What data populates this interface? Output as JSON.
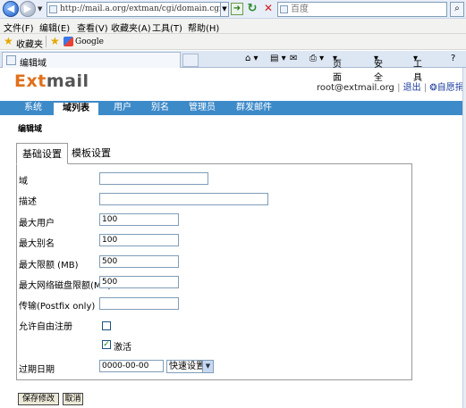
{
  "browser": {
    "address": "http://mail.а.org/extman/cgi/domain.cgi?_",
    "search_placeholder": "百度",
    "menu": [
      "文件(F)",
      "编辑(E)",
      "查看(V)",
      "收藏夹(A)",
      "工具(T)",
      "帮助(H)"
    ],
    "favorites_label": "收藏夹",
    "favorite_link": "Google",
    "tab_title": "编辑域",
    "toolbar": {
      "page": "页面",
      "safety": "安全",
      "tools": "工具"
    }
  },
  "app": {
    "logo_ext": "Ext",
    "logo_mail": "mail",
    "user": "root@extmail.org",
    "sep1": "|",
    "logout": "退出",
    "sep2": "|",
    "donate": "自愿捐助"
  },
  "nav": [
    "系统",
    "域列表",
    "用户",
    "别名",
    "管理员",
    "群发邮件"
  ],
  "page_title": "编辑域",
  "form_tabs": [
    "基础设置",
    "模板设置"
  ],
  "fields": {
    "domain_label": "域",
    "domain_value": "",
    "desc_label": "描述",
    "desc_value": "",
    "max_users_label": "最大用户",
    "max_users_value": "100",
    "max_alias_label": "最大别名",
    "max_alias_value": "100",
    "max_quota_label": "最大限额 (MB)",
    "max_quota_value": "500",
    "max_netdisk_label": "最大网络磁盘限额(MB)",
    "max_netdisk_value": "500",
    "transport_label": "传输(Postfix only)",
    "transport_value": "",
    "allow_signup_label": "允许自由注册",
    "allow_signup_checked": false,
    "active_label": "激活",
    "active_checked": true,
    "expire_label": "过期日期",
    "expire_value": "0000-00-00",
    "quick_set_label": "快速设置"
  },
  "buttons": {
    "save": "保存修改",
    "cancel": "取消"
  },
  "colors": {
    "nav_band": "#3d8ac9",
    "logo_ext": "#e0701a"
  }
}
